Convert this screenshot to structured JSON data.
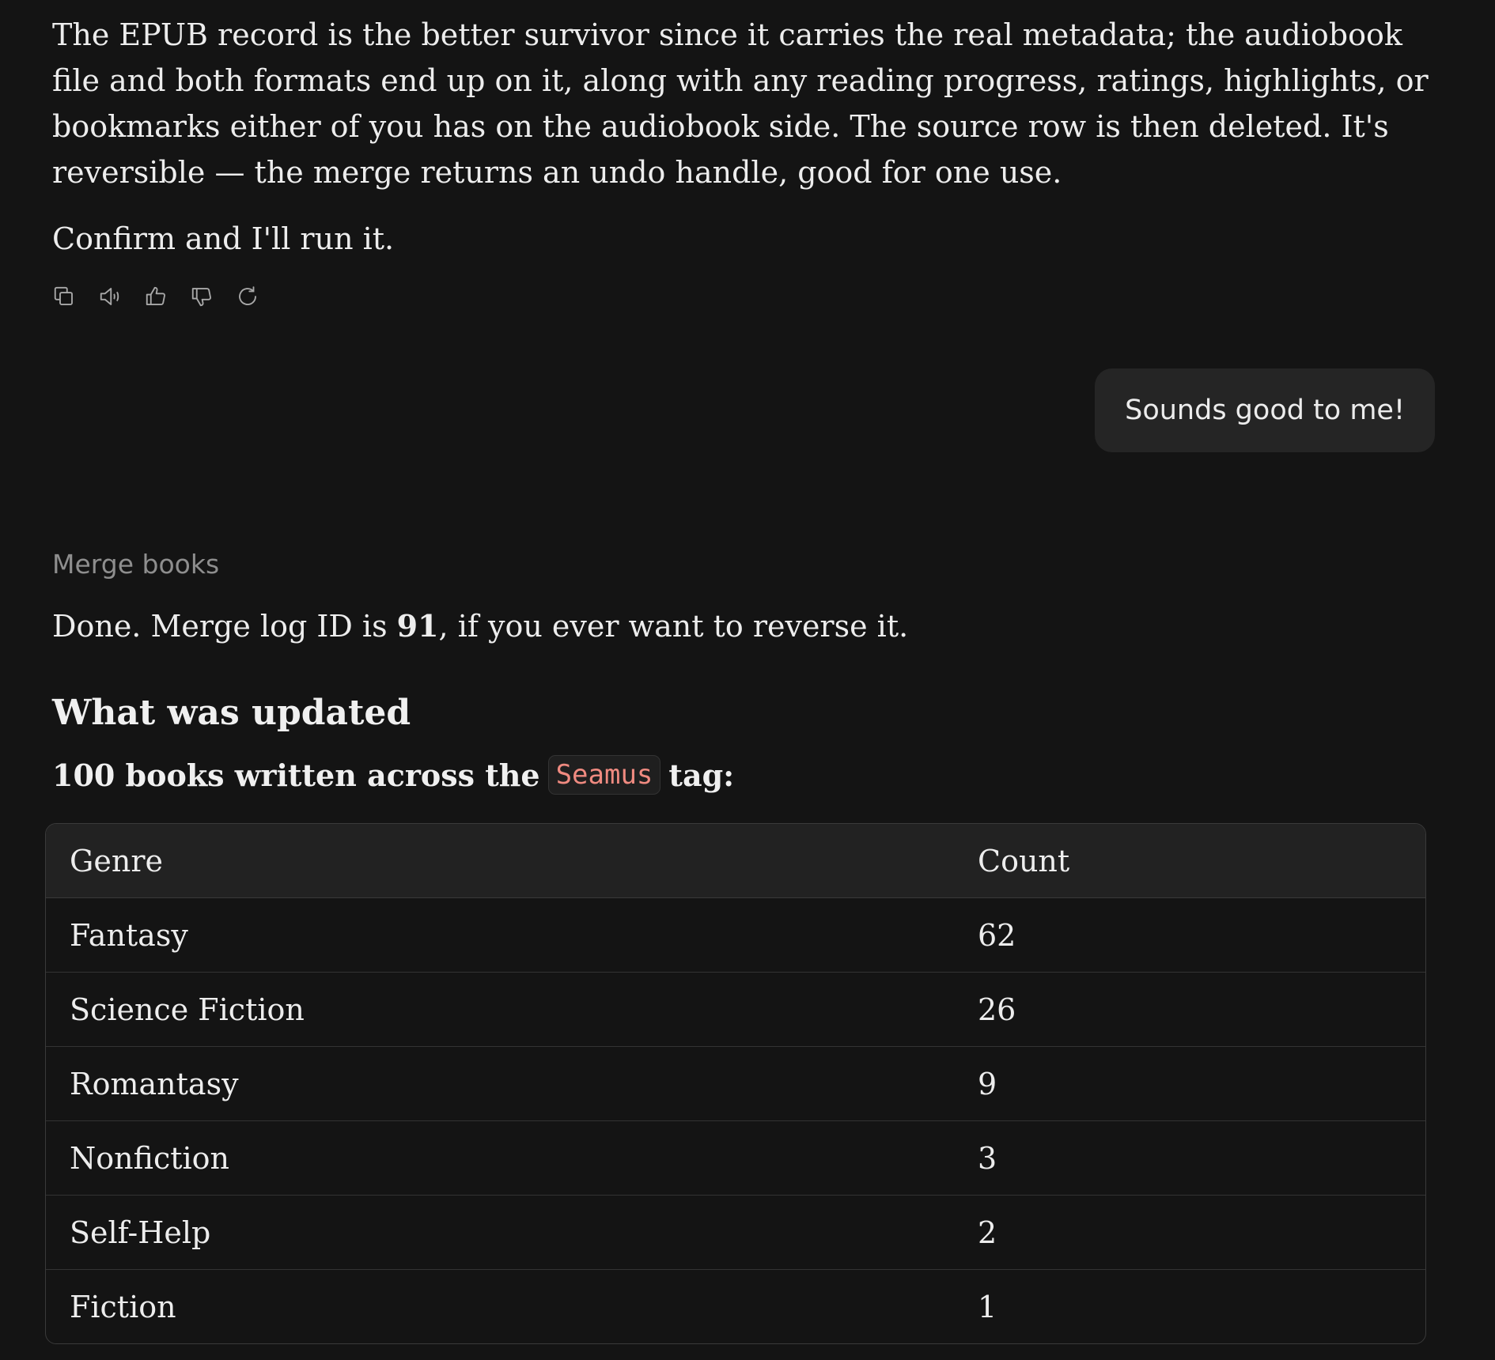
{
  "assistant_top": {
    "paragraph": "The EPUB record is the better survivor since it carries the real metadata; the audiobook file and both formats end up on it, along with any reading progress, ratings, highlights, or bookmarks either of you has on the audiobook side. The source row is then deleted. It's reversible — the merge returns an undo handle, good for one use.",
    "confirm": "Confirm and I'll run it."
  },
  "actions": [
    {
      "icon": "copy-icon"
    },
    {
      "icon": "speaker-icon"
    },
    {
      "icon": "thumbs-up-icon"
    },
    {
      "icon": "thumbs-down-icon"
    },
    {
      "icon": "regenerate-icon"
    }
  ],
  "user_message": "Sounds good to me!",
  "tool": {
    "label": "Merge books"
  },
  "result": {
    "text_before": "Done. Merge log ID is ",
    "id": "91",
    "text_after": ", if you ever want to reverse it."
  },
  "section": {
    "heading": "What was updated",
    "sub_before": "100 books written across the ",
    "tag": "Seamus",
    "sub_after": " tag:"
  },
  "table": {
    "headers": [
      "Genre",
      "Count"
    ],
    "rows": [
      [
        "Fantasy",
        "62"
      ],
      [
        "Science Fiction",
        "26"
      ],
      [
        "Romantasy",
        "9"
      ],
      [
        "Nonfiction",
        "3"
      ],
      [
        "Self-Help",
        "2"
      ],
      [
        "Fiction",
        "1"
      ]
    ]
  },
  "colors": {
    "background": "#141414",
    "text": "#ececec",
    "muted": "#8e8e8e",
    "bubble": "#252525",
    "code": "#ef8a80"
  }
}
